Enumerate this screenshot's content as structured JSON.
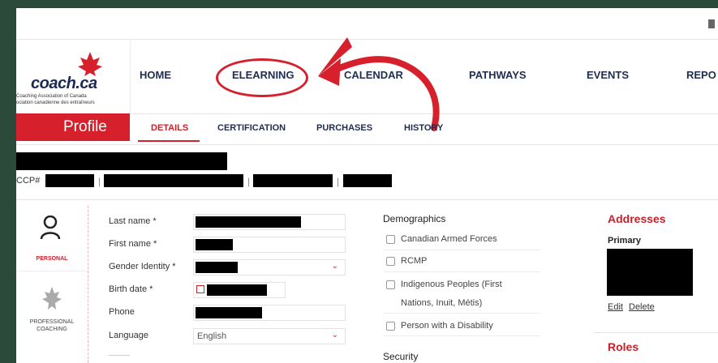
{
  "brand": {
    "wordmark": "coach.ca",
    "tagline_en": "Coaching Association of Canada",
    "tagline_fr": "ociation canadienne des entraîneurs",
    "accent_color": "#d6202c",
    "navy_color": "#1f2d4e"
  },
  "nav": {
    "items": [
      {
        "label": "HOME"
      },
      {
        "label": "ELEARNING"
      },
      {
        "label": "CALENDAR"
      },
      {
        "label": "PATHWAYS"
      },
      {
        "label": "EVENTS"
      },
      {
        "label": "REPO"
      }
    ]
  },
  "subnav": {
    "profile_label": "Profile",
    "tabs": [
      {
        "label": "DETAILS",
        "active": true
      },
      {
        "label": "CERTIFICATION"
      },
      {
        "label": "PURCHASES"
      },
      {
        "label": "HISTORY"
      }
    ]
  },
  "member": {
    "ccp_prefix": "CCP#"
  },
  "sidebar": {
    "personal_label": "PERSONAL",
    "professional_label_1": "PROFESSIONAL",
    "professional_label_2": "COACHING"
  },
  "form": {
    "last_name_label": "Last name *",
    "first_name_label": "First name *",
    "gender_label": "Gender Identity *",
    "birth_label": "Birth date *",
    "phone_label": "Phone",
    "language_label": "Language",
    "language_value": "English"
  },
  "demographics": {
    "title": "Demographics",
    "options": [
      {
        "label": "Canadian Armed Forces",
        "checked": false
      },
      {
        "label": "RCMP",
        "checked": false
      },
      {
        "label": "Indigenous Peoples (First",
        "checked": false
      },
      {
        "label": "Person with a Disability",
        "checked": false
      }
    ],
    "indigenous_cont": "Nations, Inuit, Métis)",
    "security_title": "Security"
  },
  "addresses": {
    "title": "Addresses",
    "primary_label": "Primary",
    "edit_label": "Edit",
    "delete_label": "Delete",
    "roles_title": "Roles"
  }
}
